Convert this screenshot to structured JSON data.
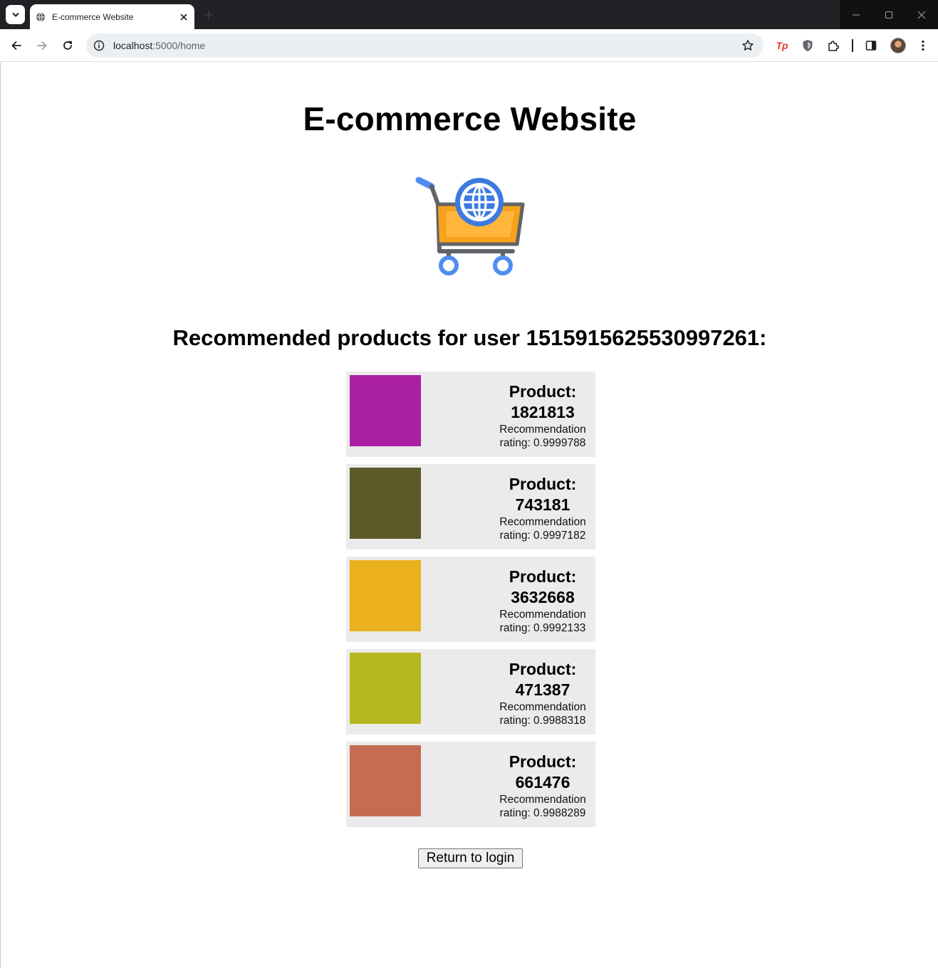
{
  "browser": {
    "tab_title": "E-commerce Website",
    "url_host": "localhost",
    "url_path": ":5000/home",
    "extension_tp_label": "Tp"
  },
  "page": {
    "title": "E-commerce Website",
    "logo_icon": "shopping-cart-globe-icon",
    "recommend_heading": "Recommended products for user 1515915625530997261:",
    "products": [
      {
        "product_label": "Product:",
        "product_id": "1821813",
        "rating_label": "Recommendation",
        "rating_value": "rating: 0.9999788",
        "color": "#aa1fa1"
      },
      {
        "product_label": "Product:",
        "product_id": "743181",
        "rating_label": "Recommendation",
        "rating_value": "rating: 0.9997182",
        "color": "#5b5a29"
      },
      {
        "product_label": "Product:",
        "product_id": "3632668",
        "rating_label": "Recommendation",
        "rating_value": "rating: 0.9992133",
        "color": "#eab01d"
      },
      {
        "product_label": "Product:",
        "product_id": "471387",
        "rating_label": "Recommendation",
        "rating_value": "rating: 0.9988318",
        "color": "#b5b91f"
      },
      {
        "product_label": "Product:",
        "product_id": "661476",
        "rating_label": "Recommendation",
        "rating_value": "rating: 0.9988289",
        "color": "#c66c53"
      }
    ],
    "return_button": "Return to login"
  }
}
